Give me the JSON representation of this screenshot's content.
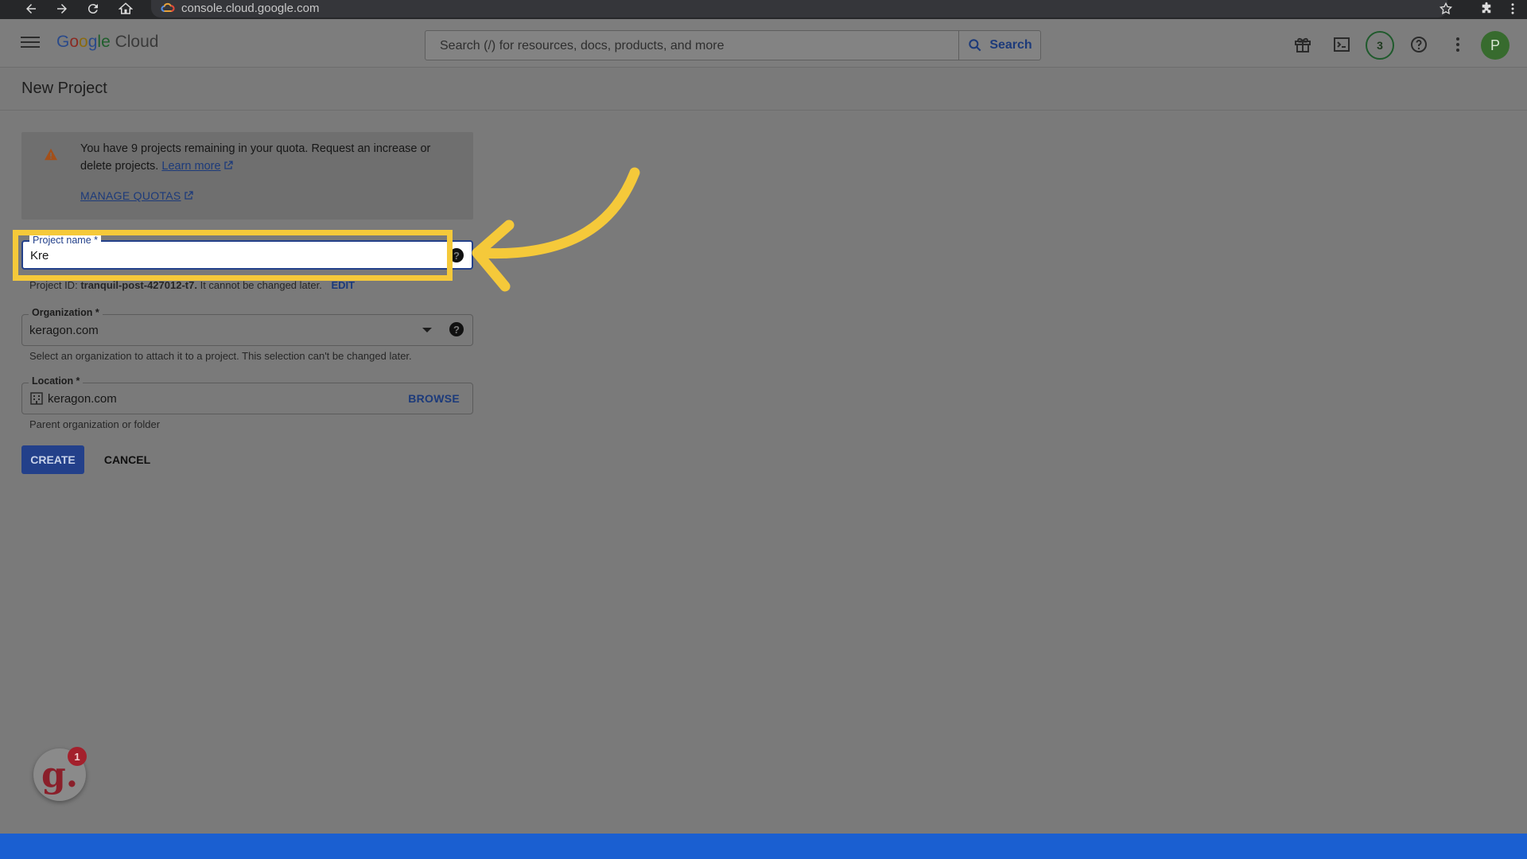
{
  "browser": {
    "url": "console.cloud.google.com"
  },
  "header": {
    "logo_parts": [
      "G",
      "o",
      "o",
      "g",
      "le",
      " Cloud"
    ],
    "search_placeholder": "Search (/) for resources, docs, products, and more",
    "search_button_label": "Search",
    "notification_count": "3",
    "avatar_initial": "P"
  },
  "page": {
    "title": "New Project"
  },
  "quota_notice": {
    "text": "You have 9 projects remaining in your quota. Request an increase or delete projects.",
    "learn_more_label": "Learn more",
    "manage_quotas_label": "MANAGE QUOTAS"
  },
  "form": {
    "project_name": {
      "label": "Project name *",
      "value": "Kre"
    },
    "project_id": {
      "prefix": "Project ID:",
      "value": "tranquil-post-427012-t7.",
      "suffix": "It cannot be changed later.",
      "edit_label": "EDIT"
    },
    "organization": {
      "label": "Organization *",
      "value": "keragon.com",
      "hint": "Select an organization to attach it to a project. This selection can't be changed later."
    },
    "location": {
      "label": "Location *",
      "value": "keragon.com",
      "browse_label": "BROWSE",
      "hint": "Parent organization or folder"
    },
    "create_label": "CREATE",
    "cancel_label": "CANCEL"
  },
  "widget": {
    "letter": "g.",
    "badge_count": "1"
  },
  "colors": {
    "highlight": "#f5c93a",
    "primary_blue": "#23408a",
    "bottom_bar": "#1a5fd1"
  }
}
